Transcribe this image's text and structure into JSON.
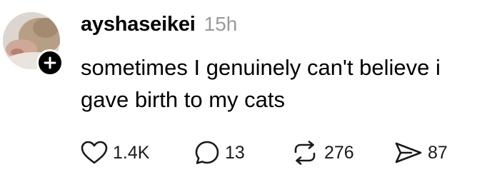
{
  "post": {
    "username": "ayshaseikei",
    "timestamp": "15h",
    "text": "sometimes I genuinely can't believe i gave birth to my cats"
  },
  "actions": {
    "likes": "1.4K",
    "replies": "13",
    "reposts": "276",
    "shares": "87"
  },
  "icons": {
    "like": "heart-icon",
    "reply": "comment-bubble-icon",
    "repost": "repost-arrows-icon",
    "share": "send-icon",
    "follow": "plus-icon"
  },
  "colors": {
    "text": "#000000",
    "muted": "#9a9a9a",
    "badge": "#000000"
  }
}
